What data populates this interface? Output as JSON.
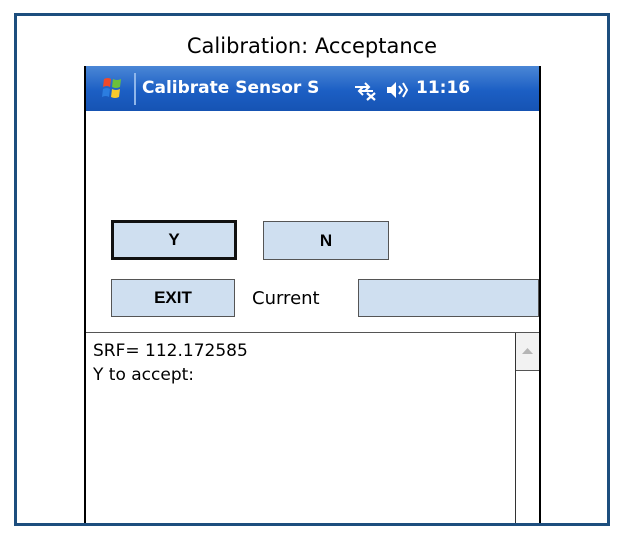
{
  "caption": "Calibration: Acceptance",
  "titlebar": {
    "title": "Calibrate Sensor S",
    "time": "11:16",
    "icons": [
      "windows-start-icon",
      "connectivity-icon",
      "volume-icon"
    ]
  },
  "buttons": {
    "yes": "Y",
    "no": "N",
    "exit": "EXIT"
  },
  "current": {
    "label": "Current",
    "value": ""
  },
  "output": {
    "line1": "SRF= 112.172585",
    "line2": "Y to accept:"
  },
  "colors": {
    "frame_border": "#1d4e7e",
    "titlebar": "#1c5fc4",
    "button_fill": "#cfdff0"
  }
}
